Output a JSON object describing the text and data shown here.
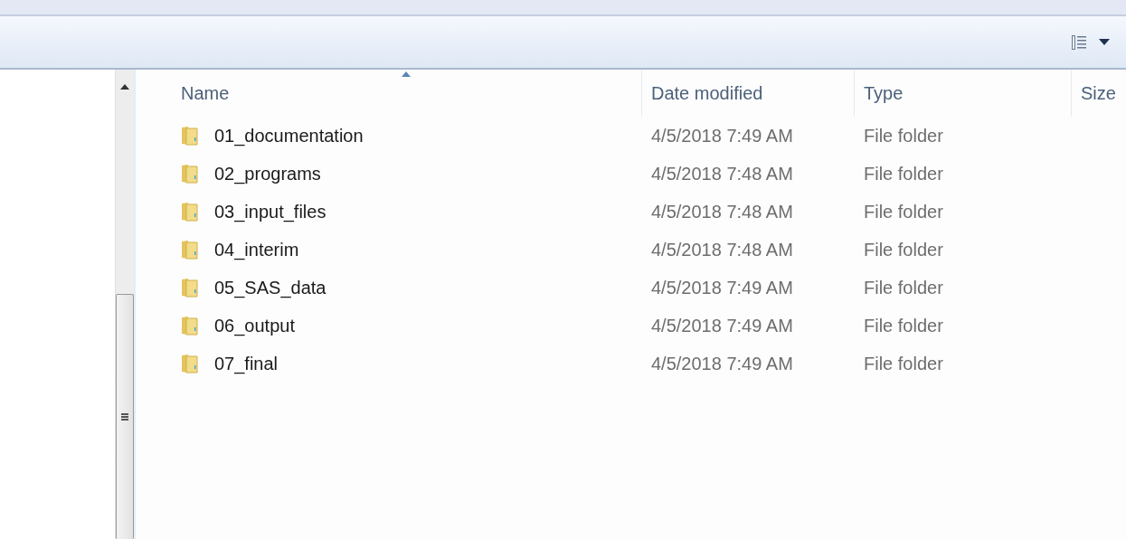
{
  "columns": [
    {
      "label": "Name",
      "sorted": true
    },
    {
      "label": "Date modified",
      "sorted": false
    },
    {
      "label": "Type",
      "sorted": false
    },
    {
      "label": "Size",
      "sorted": false
    }
  ],
  "rows": [
    {
      "name": "01_documentation",
      "date": "4/5/2018 7:49 AM",
      "type": "File folder"
    },
    {
      "name": "02_programs",
      "date": "4/5/2018 7:48 AM",
      "type": "File folder"
    },
    {
      "name": "03_input_files",
      "date": "4/5/2018 7:48 AM",
      "type": "File folder"
    },
    {
      "name": "04_interim",
      "date": "4/5/2018 7:48 AM",
      "type": "File folder"
    },
    {
      "name": "05_SAS_data",
      "date": "4/5/2018 7:49 AM",
      "type": "File folder"
    },
    {
      "name": "06_output",
      "date": "4/5/2018 7:49 AM",
      "type": "File folder"
    },
    {
      "name": "07_final",
      "date": "4/5/2018 7:49 AM",
      "type": "File folder"
    }
  ]
}
